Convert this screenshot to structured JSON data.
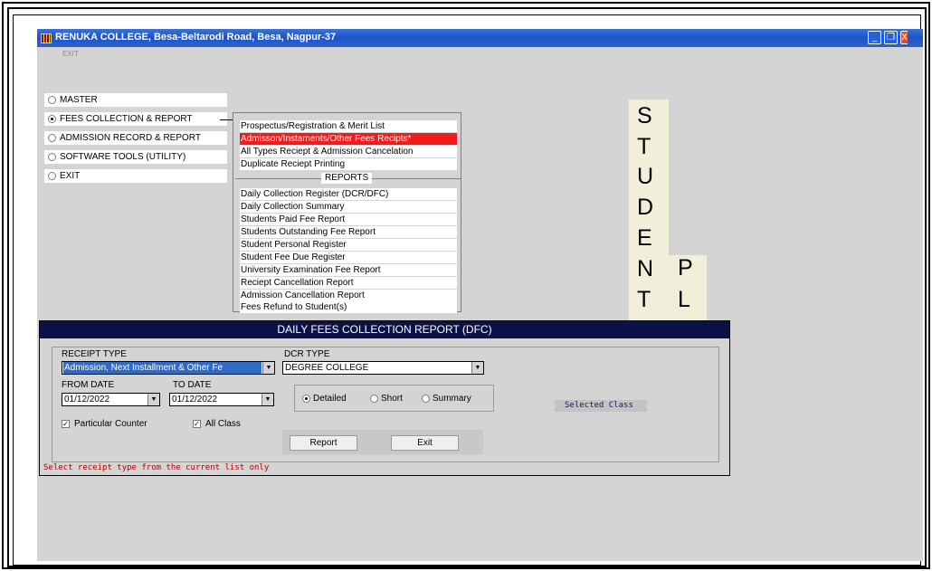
{
  "window": {
    "title": "RENUKA COLLEGE, Besa-Beltarodi Road, Besa, Nagpur-37",
    "controls": {
      "minimize": "_",
      "restore": "❐",
      "close": "X"
    }
  },
  "menubar": {
    "exit_label": "EXIT"
  },
  "main_nav": {
    "items": [
      {
        "label": "MASTER",
        "selected": false
      },
      {
        "label": "FEES COLLECTION & REPORT",
        "selected": true
      },
      {
        "label": "ADMISSION RECORD & REPORT",
        "selected": false
      },
      {
        "label": "SOFTWARE TOOLS (UTILITY)",
        "selected": false
      },
      {
        "label": "EXIT",
        "selected": false
      }
    ]
  },
  "submenu": {
    "items": [
      "Prospectus/Registration & Merit List",
      "Admisson/Instaments/Other Fees Recipts*",
      "All Types Reciept & Admission Cancelation",
      "Duplicate Reciept Printing"
    ],
    "active_index": 1,
    "reports_heading": "REPORTS",
    "reports": [
      "Daily Collection Register (DCR/DFC)",
      "Daily Collection Summary",
      "Students Paid Fee Report",
      "Students Outstanding Fee Report",
      "Student Personal Register",
      "Student Fee Due Register",
      "University Examination Fee Report",
      "Reciept Cancellation Report",
      "Admission Cancellation Report",
      "Fees Refund to Student(s)"
    ]
  },
  "banner": {
    "word1": [
      "S",
      "T",
      "U",
      "D",
      "E",
      "N",
      "T"
    ],
    "word2": [
      "P",
      "L"
    ]
  },
  "dfc": {
    "title": "DAILY FEES COLLECTION REPORT (DFC)",
    "receipt_type_label": "RECEIPT TYPE",
    "receipt_type_value": "Admission, Next Installment & Other Fe",
    "dcr_type_label": "DCR TYPE",
    "dcr_type_value": "DEGREE COLLEGE",
    "from_date_label": "FROM DATE",
    "from_date_value": "01/12/2022",
    "to_date_label": "TO DATE",
    "to_date_value": "01/12/2022",
    "options": [
      {
        "label": "Detailed",
        "selected": true
      },
      {
        "label": "Short",
        "selected": false
      },
      {
        "label": "Summary",
        "selected": false
      }
    ],
    "particular_counter_label": "Particular Counter",
    "particular_counter_checked": true,
    "all_class_label": "All Class",
    "all_class_checked": true,
    "selected_class_label": "Selected Class",
    "report_button": "Report",
    "exit_button": "Exit",
    "status_message": "Select receipt type from the current list only"
  },
  "colors": {
    "titlebar": "#1d55c9",
    "active_menu": "#ee1c1c",
    "dfc_header": "#0a1247",
    "banner": "#f1efd9",
    "status_text": "#b00000"
  }
}
